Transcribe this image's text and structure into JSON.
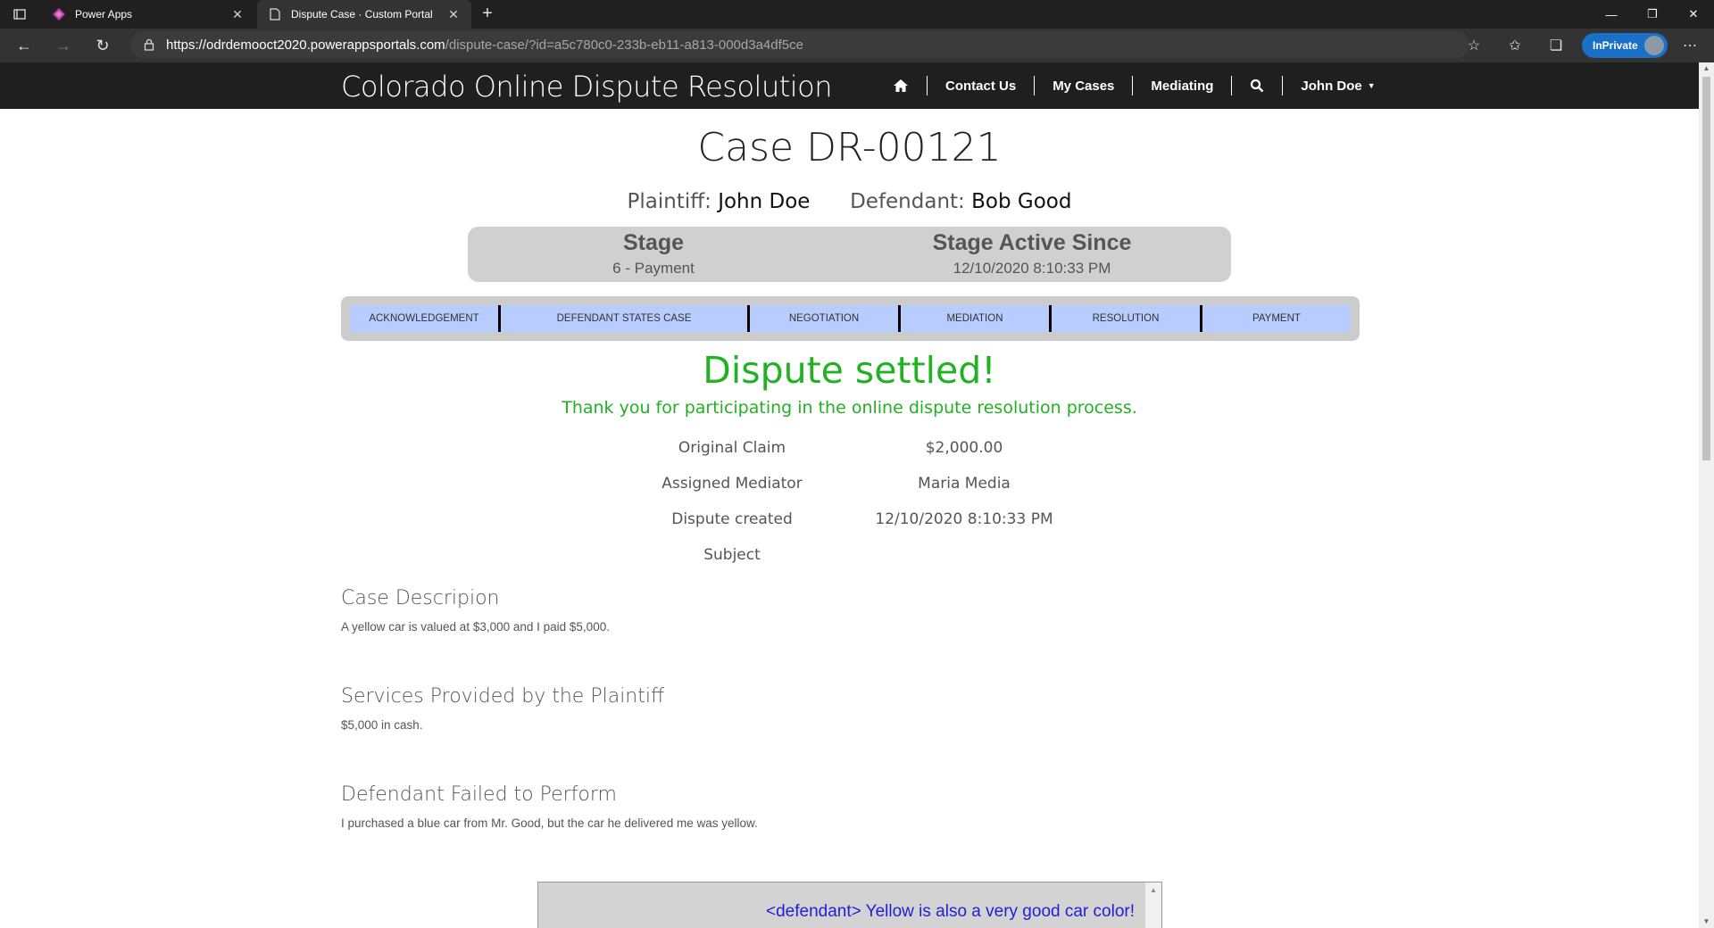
{
  "browser": {
    "tabs": [
      {
        "label": "Power Apps",
        "icon": "power-apps-icon"
      },
      {
        "label": "Dispute Case · Custom Portal",
        "icon": "page-icon"
      }
    ],
    "url_host": "https://odrdemooct2020.powerappsportals.com",
    "url_path": "/dispute-case/?id=a5c780c0-233b-eb11-a813-000d3a4df5ce",
    "inprivate_label": "InPrivate",
    "accent": "#1a6fc7"
  },
  "site": {
    "brand": "Colorado Online Dispute Resolution",
    "nav": {
      "contact": "Contact Us",
      "my_cases": "My Cases",
      "mediating": "Mediating",
      "user": "John Doe"
    }
  },
  "case": {
    "title": "Case DR-00121",
    "plaintiff_label": "Plaintiff:",
    "plaintiff": "John Doe",
    "defendant_label": "Defendant:",
    "defendant": "Bob Good",
    "stage_label": "Stage",
    "stage": "6 - Payment",
    "active_since_label": "Stage Active Since",
    "active_since": "12/10/2020 8:10:33 PM"
  },
  "progress_steps": [
    "ACKNOWLEDGEMENT",
    "DEFENDANT STATES CASE",
    "NEGOTIATION",
    "MEDIATION",
    "RESOLUTION",
    "PAYMENT"
  ],
  "status": {
    "headline": "Dispute settled!",
    "message": "Thank you for participating in the online dispute resolution process.",
    "color": "#22b122"
  },
  "details": {
    "original_claim_label": "Original Claim",
    "original_claim": "$2,000.00",
    "mediator_label": "Assigned Mediator",
    "mediator": "Maria Media",
    "created_label": "Dispute created",
    "created": "12/10/2020 8:10:33 PM",
    "subject_label": "Subject",
    "subject": ""
  },
  "sections": {
    "description_title": "Case Descripion",
    "description_body": "A yellow car is valued at $3,000 and I paid $5,000.",
    "services_title": "Services Provided by the Plaintiff",
    "services_body": "$5,000 in cash.",
    "failed_title": "Defendant Failed to Perform",
    "failed_body": "I purchased a blue car from Mr. Good, but the car he delivered me was yellow."
  },
  "chat": {
    "message": "<defendant> Yellow is also a very good car color!"
  }
}
